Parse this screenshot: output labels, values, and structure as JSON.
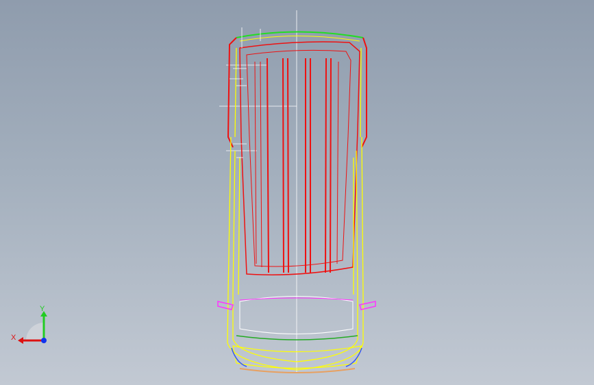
{
  "viewport": {
    "background_top": "#8f9cad",
    "background_bottom": "#c2c9d3"
  },
  "model": {
    "description_icon": "vehicle-wireframe-top-view",
    "colors": {
      "body": "#ee1111",
      "trim": "#ffff00",
      "roof_edge": "#22dd22",
      "accent": "#ff33ff",
      "white": "#ffffff",
      "blue": "#3355ff",
      "orange": "#e8a060"
    }
  },
  "triad": {
    "x_label": "X",
    "y_label": "Y",
    "x_color": "#dd1111",
    "y_color": "#22cc22",
    "z_color": "#1133ee"
  }
}
